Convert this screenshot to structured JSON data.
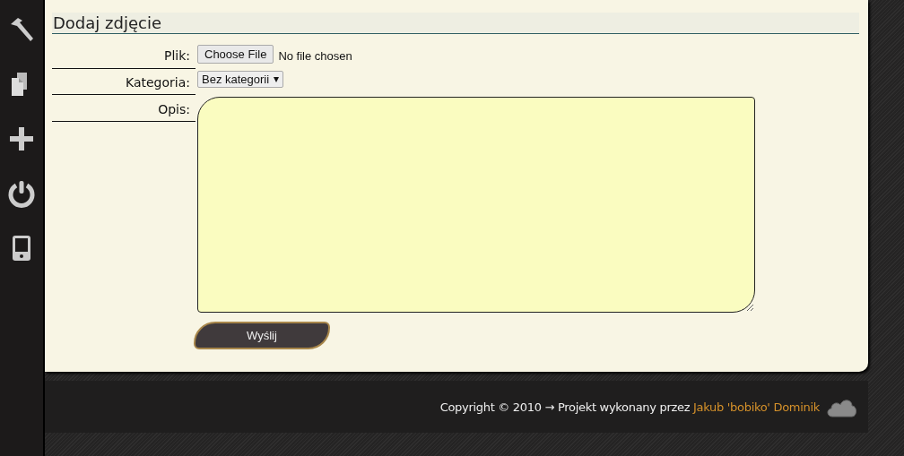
{
  "panel": {
    "title": "Dodaj zdjęcie"
  },
  "form": {
    "fields": [
      {
        "kind": "file",
        "label": "Plik:",
        "button": "Choose File",
        "status": "No file chosen"
      },
      {
        "kind": "select",
        "label": "Kategoria:",
        "value": "Bez kategorii"
      },
      {
        "kind": "textarea",
        "label": "Opis:"
      }
    ],
    "submit": "Wyślij"
  },
  "footer": {
    "text": "Copyright © 2010 → Projekt wykonany przez ",
    "author": "Jakub 'bobiko' Dominik"
  }
}
